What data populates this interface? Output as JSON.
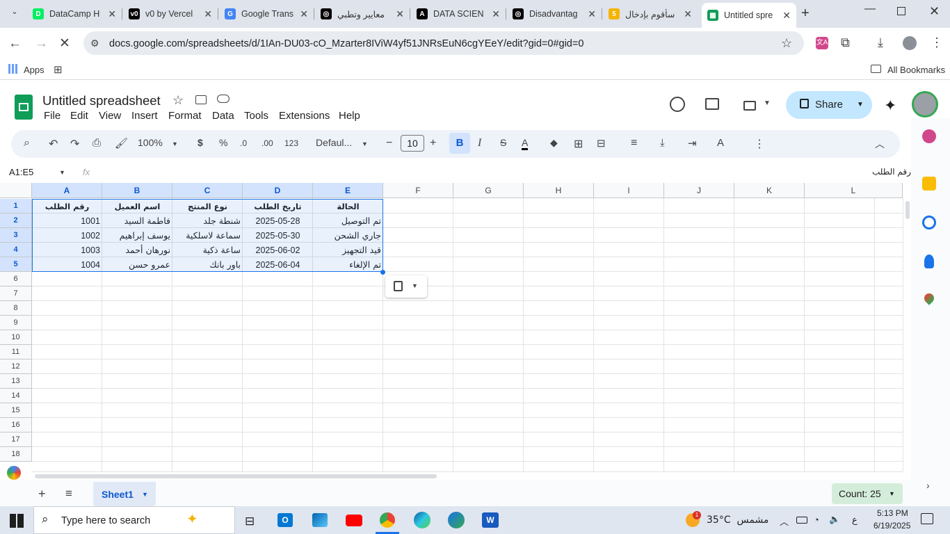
{
  "browser": {
    "tabs": [
      {
        "title": "DataCamp H",
        "color": "#03ef62",
        "glyph": "D"
      },
      {
        "title": "v0 by Vercel",
        "color": "#000000",
        "glyph": "v0"
      },
      {
        "title": "Google Trans",
        "color": "#4285f4",
        "glyph": "G"
      },
      {
        "title": "معايير وتطبي",
        "color": "#000000",
        "glyph": "◎"
      },
      {
        "title": "DATA SCIEN",
        "color": "#000000",
        "glyph": "A"
      },
      {
        "title": "Disadvantag",
        "color": "#000000",
        "glyph": "◎"
      },
      {
        "title": "سأقوم بإدخال",
        "color": "#f4b400",
        "glyph": "5"
      },
      {
        "title": "Untitled spre",
        "color": "#0f9d58",
        "glyph": "▦"
      }
    ],
    "url": "docs.google.com/spreadsheets/d/1IAn-DU03-cO_Mzarter8IViW4yf51JNRsEuN6cgYEeY/edit?gid=0#gid=0",
    "bookmarks": {
      "apps": "Apps",
      "all": "All Bookmarks"
    }
  },
  "sheets": {
    "title": "Untitled spreadsheet",
    "menu": [
      "File",
      "Edit",
      "View",
      "Insert",
      "Format",
      "Data",
      "Tools",
      "Extensions",
      "Help"
    ],
    "share": "Share",
    "toolbar": {
      "zoom": "100%",
      "currency": "$",
      "percent": "%",
      "dec_minus": ".0",
      "dec_plus": ".00",
      "num_format": "123",
      "font": "Defaul...",
      "font_size": "10"
    },
    "name_box": "A1:E5",
    "formula_value": "رقم الطلب",
    "fx": "fx",
    "columns": [
      "A",
      "B",
      "C",
      "D",
      "E",
      "F",
      "G",
      "H",
      "I",
      "J",
      "K",
      "L"
    ],
    "rows": [
      "1",
      "2",
      "3",
      "4",
      "5",
      "6",
      "7",
      "8",
      "9",
      "10",
      "11",
      "12",
      "13",
      "14",
      "15",
      "16",
      "17",
      "18"
    ],
    "table": [
      [
        "رقم الطلب",
        "اسم العميل",
        "نوع المنتج",
        "تاريخ الطلب",
        "الحالة"
      ],
      [
        "1001",
        "فاطمة السيد",
        "شنطة جلد",
        "2025-05-28",
        "تم التوصيل"
      ],
      [
        "1002",
        "يوسف إبراهيم",
        "سماعة لاسلكية",
        "2025-05-30",
        "جاري الشحن"
      ],
      [
        "1003",
        "نورهان أحمد",
        "ساعة ذكية",
        "2025-06-02",
        "قيد التجهيز"
      ],
      [
        "1004",
        "عمرو حسن",
        "باور بانك",
        "2025-06-04",
        "تم الإلغاء"
      ]
    ],
    "sheet_tab": "Sheet1",
    "count": "Count: 25"
  },
  "taskbar": {
    "search": "Type here to search",
    "weather": "35°C  مشمس",
    "lang": "ع",
    "time": "5:13 PM",
    "date": "6/19/2025",
    "badge": "1"
  }
}
